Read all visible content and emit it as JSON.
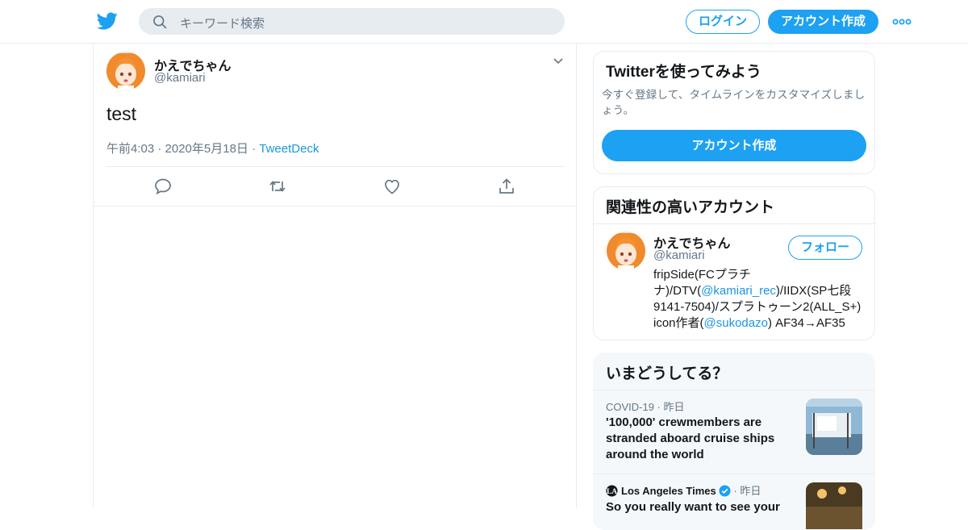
{
  "header": {
    "logo": "twitter-bird-icon",
    "search_placeholder": "キーワード検索",
    "login_label": "ログイン",
    "signup_label": "アカウント作成",
    "more_icon": "more-dots-icon"
  },
  "tweet": {
    "name": "かえでちゃん",
    "handle": "@kamiari",
    "text": "test",
    "meta": "午前4:03 · 2020年5月18日 · ",
    "source": "TweetDeck",
    "actions": [
      "reply-icon",
      "retweet-icon",
      "like-icon",
      "share-icon"
    ]
  },
  "signup_card": {
    "title": "Twitterを使ってみよう",
    "description": "今すぐ登録して、タイムラインをカスタマイズしましょう。",
    "button": "アカウント作成"
  },
  "related": {
    "title": "関連性の高いアカウント",
    "name": "かえでちゃん",
    "handle": "@kamiari",
    "follow_label": "フォロー",
    "bio_1": "fripSide(FCプラチナ)/DTV(",
    "bio_mention_1": "@kamiari_rec",
    "bio_2": ")/IIDX(SP七段 9141-7504)/スプラトゥーン2(ALL_S+) icon作者(",
    "bio_mention_2": "@sukodazo",
    "bio_3": ") AF34→AF35"
  },
  "trends": {
    "title": "いまどうしてる？",
    "items": [
      {
        "meta": "COVID-19 · 昨日",
        "headline": "'100,000' crewmembers are stranded aboard cruise ships around the world"
      },
      {
        "publisher": "Los Angeles Times",
        "time": " · 昨日",
        "headline": "So you really want to see your"
      }
    ]
  },
  "colors": {
    "brand": "#1da1f2",
    "link": "#1b95e0",
    "secondary_text": "#657786",
    "border": "#e6ecf0"
  }
}
